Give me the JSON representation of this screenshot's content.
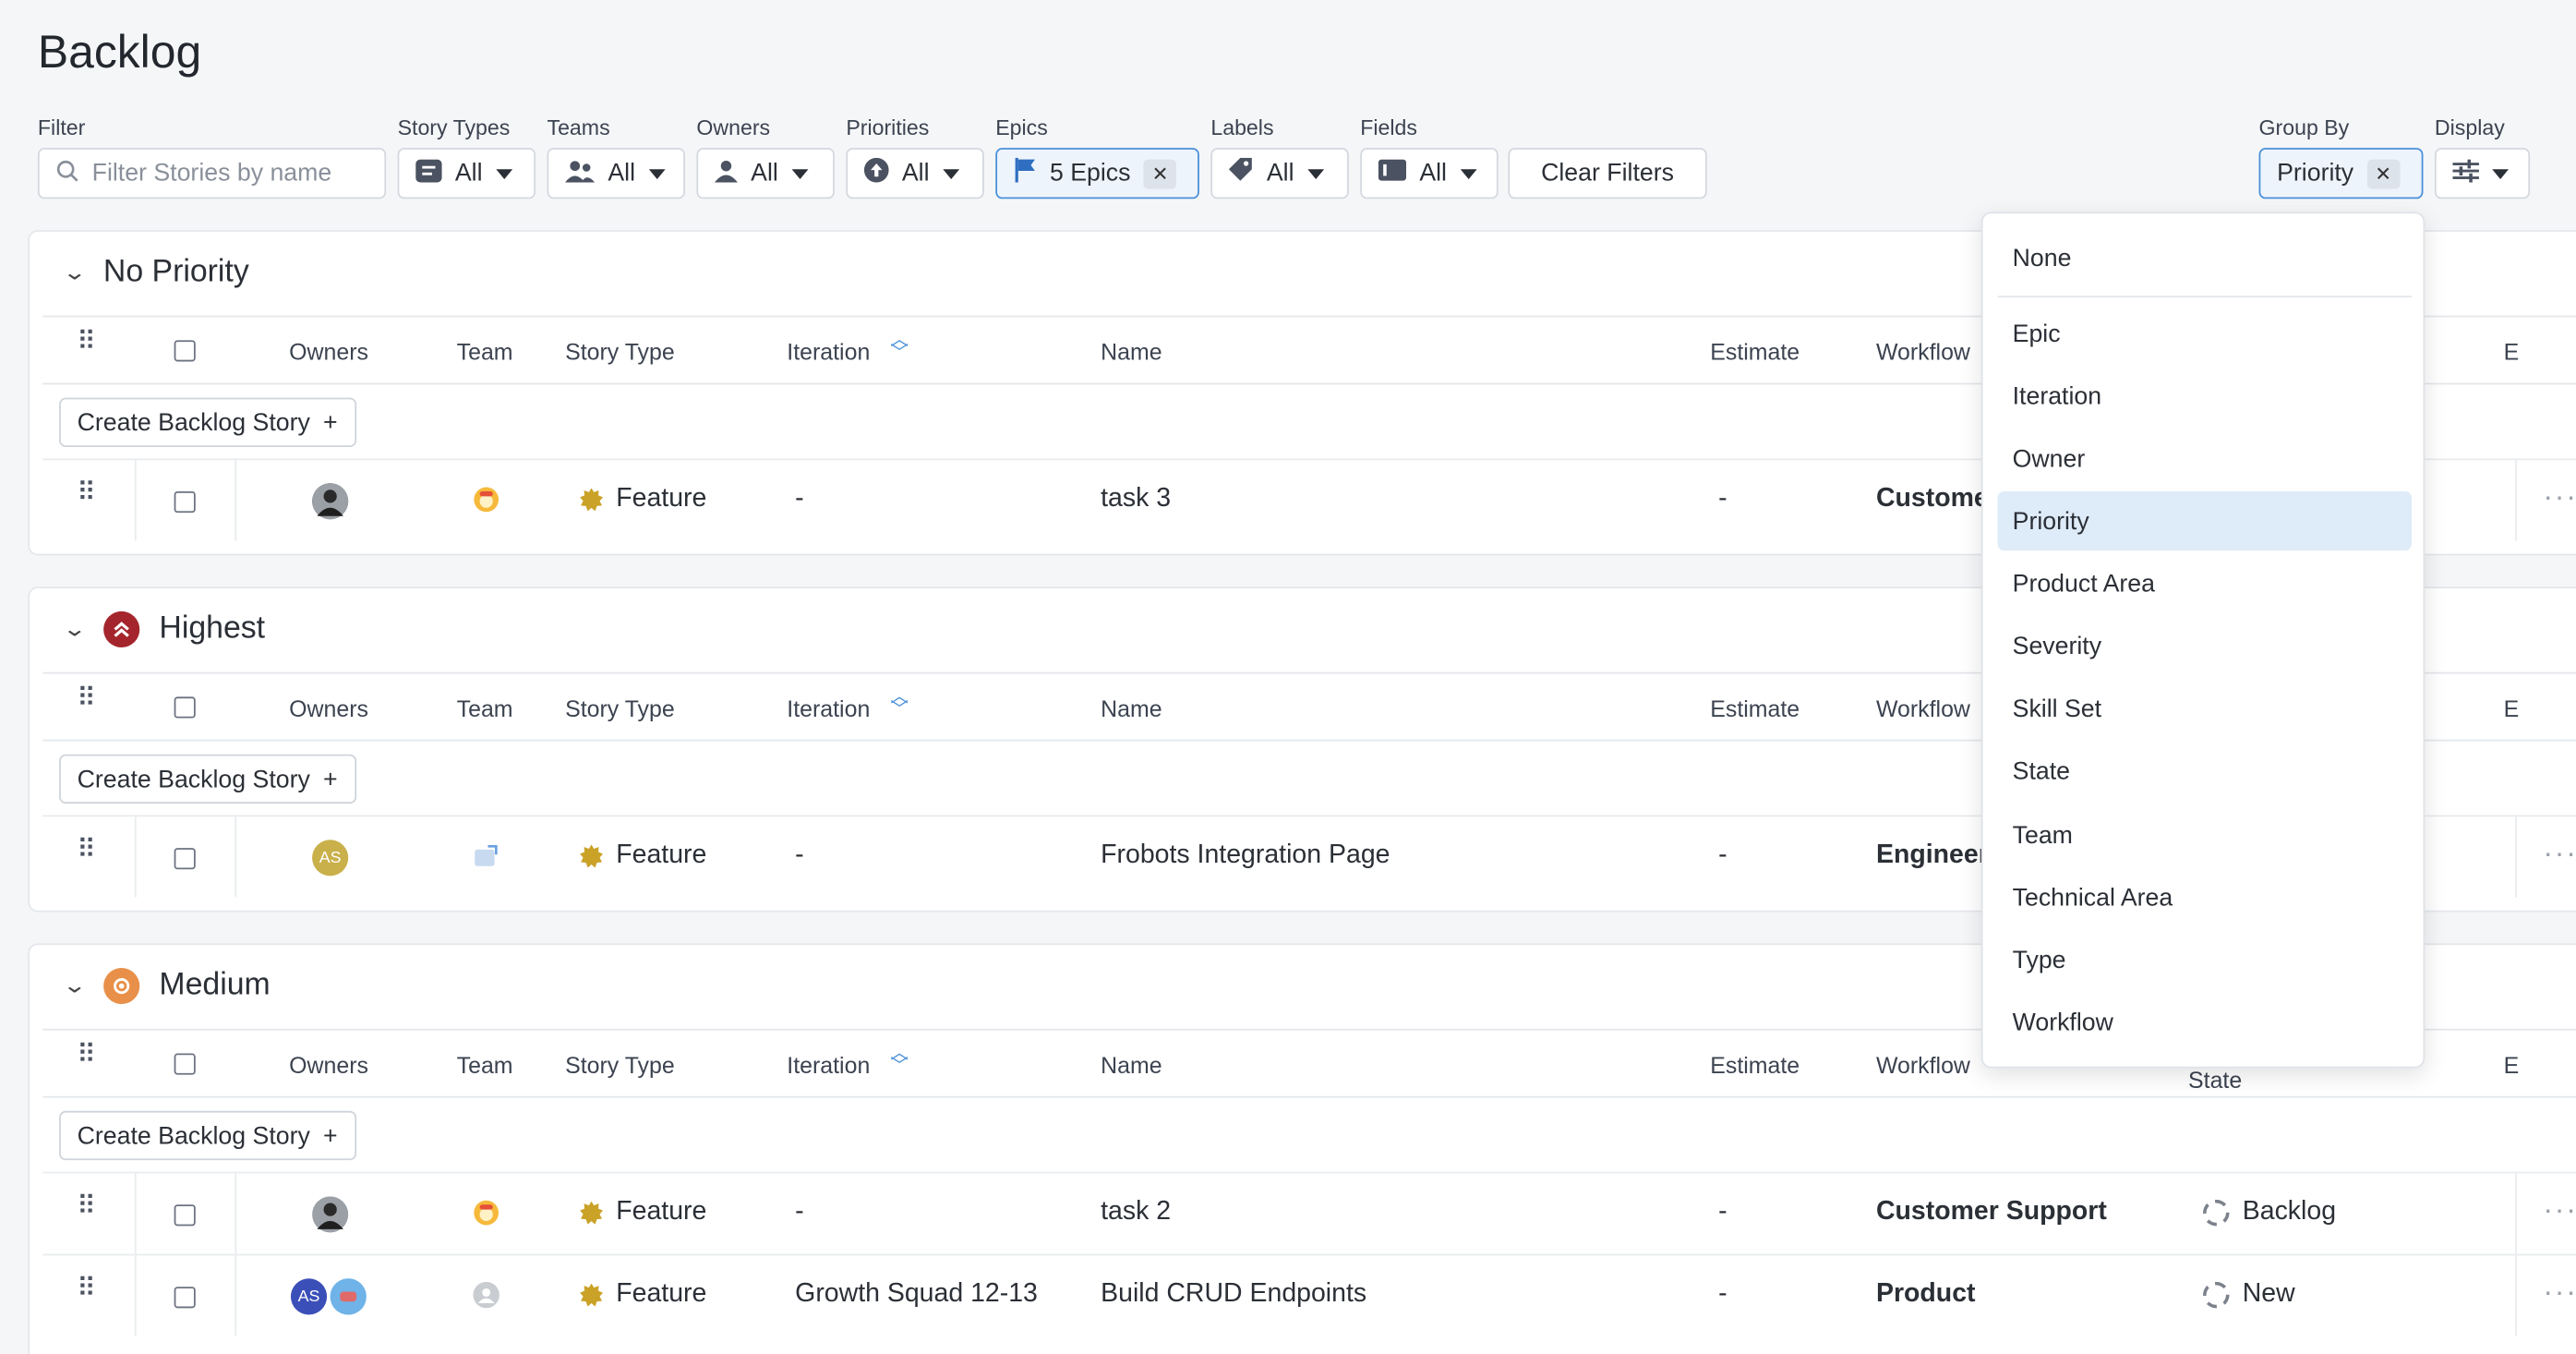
{
  "page": {
    "title": "Backlog"
  },
  "filters": {
    "filter_label": "Filter",
    "search_placeholder": "Filter Stories by name",
    "story_types": {
      "label": "Story Types",
      "value": "All"
    },
    "teams": {
      "label": "Teams",
      "value": "All"
    },
    "owners": {
      "label": "Owners",
      "value": "All"
    },
    "priorities": {
      "label": "Priorities",
      "value": "All"
    },
    "epics": {
      "label": "Epics",
      "value": "5 Epics"
    },
    "labels": {
      "label": "Labels",
      "value": "All"
    },
    "fields": {
      "label": "Fields",
      "value": "All"
    },
    "clear_label": "Clear Filters",
    "group_by": {
      "label": "Group By",
      "value": "Priority"
    },
    "display": {
      "label": "Display"
    }
  },
  "columns": {
    "owners": "Owners",
    "team": "Team",
    "story_type": "Story Type",
    "iteration": "Iteration",
    "name": "Name",
    "estimate": "Estimate",
    "workflow": "Workflow",
    "state_partial": "State",
    "e": "E"
  },
  "create_label": "Create Backlog Story",
  "groups": [
    {
      "name": "No Priority",
      "icon": "none",
      "rows": [
        {
          "owner": "photo-avatar",
          "team": "team-emoji-icon",
          "type": "Feature",
          "iteration": "-",
          "name": "task 3",
          "estimate": "-",
          "workflow": "Customer",
          "state": ""
        }
      ]
    },
    {
      "name": "Highest",
      "icon": "double-chevron-up-icon",
      "color": "#a4262c",
      "rows": [
        {
          "owner": "AS",
          "team": "team-image-icon",
          "type": "Feature",
          "iteration": "-",
          "name": "Frobots Integration Page",
          "estimate": "-",
          "workflow": "Engineeri",
          "state": ""
        }
      ]
    },
    {
      "name": "Medium",
      "icon": "circle-dot-icon",
      "color": "#e8904a",
      "rows": [
        {
          "owner": "photo-avatar",
          "team": "team-emoji-icon",
          "type": "Feature",
          "iteration": "-",
          "name": "task 2",
          "estimate": "-",
          "workflow": "Customer Support",
          "state": "Backlog"
        },
        {
          "owner": "AS",
          "team": "team-grey-icon",
          "type": "Feature",
          "iteration": "Growth Squad 12-13",
          "name": "Build CRUD Endpoints",
          "estimate": "-",
          "workflow": "Product",
          "state": "New"
        }
      ]
    }
  ],
  "group_by_menu": {
    "items": [
      "None",
      "Epic",
      "Iteration",
      "Owner",
      "Priority",
      "Product Area",
      "Severity",
      "Skill Set",
      "State",
      "Team",
      "Technical Area",
      "Type",
      "Workflow"
    ],
    "selected": "Priority"
  },
  "colors": {
    "accent": "#4a90d9",
    "selected_bg": "#deebf8",
    "feature_star": "#c9a227"
  }
}
